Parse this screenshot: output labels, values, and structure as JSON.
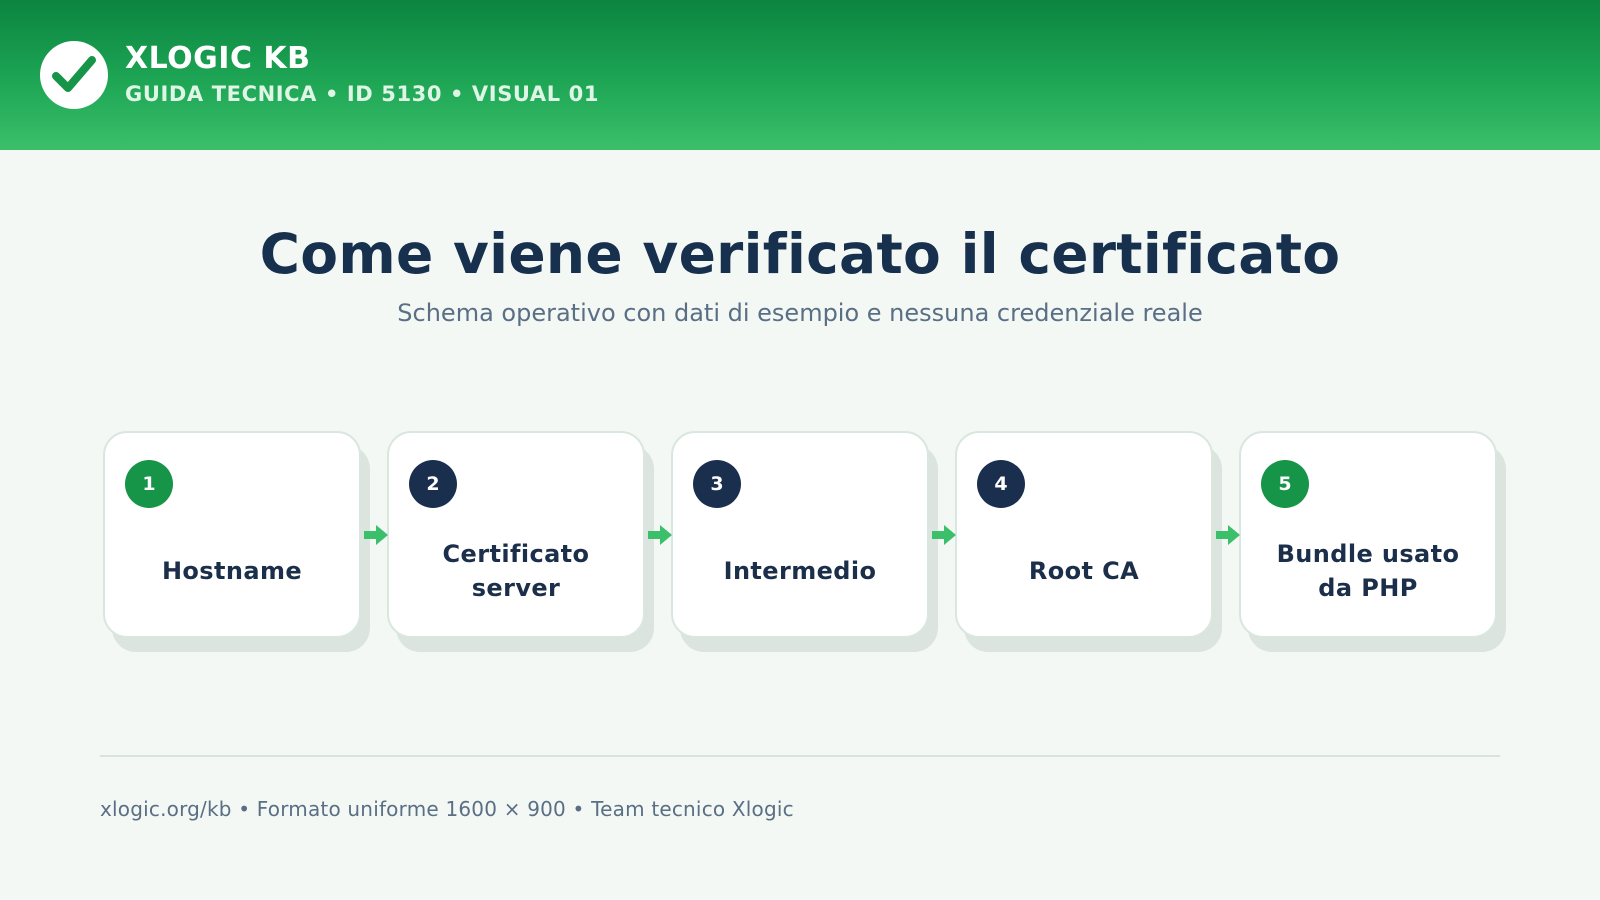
{
  "header": {
    "brand": "XLOGIC KB",
    "subtitle": "GUIDA TECNICA • ID 5130 • VISUAL 01",
    "logo_icon": "check-icon"
  },
  "title": "Come viene verificato il certificato",
  "subtitle": "Schema operativo con dati di esempio e nessuna credenziale reale",
  "steps": [
    {
      "number": "1",
      "label": "Hostname",
      "badge_color": "#169447"
    },
    {
      "number": "2",
      "label": "Certificato server",
      "badge_color": "#1a2f4d"
    },
    {
      "number": "3",
      "label": "Intermedio",
      "badge_color": "#1a2f4d"
    },
    {
      "number": "4",
      "label": "Root CA",
      "badge_color": "#1a2f4d"
    },
    {
      "number": "5",
      "label": "Bundle usato da PHP",
      "badge_color": "#169447"
    }
  ],
  "footer": "xlogic.org/kb • Formato uniforme 1600 × 900 • Team tecnico Xlogic",
  "colors": {
    "accent": "#22a85a",
    "navy": "#17304d",
    "arrow": "#3bbf6a"
  }
}
